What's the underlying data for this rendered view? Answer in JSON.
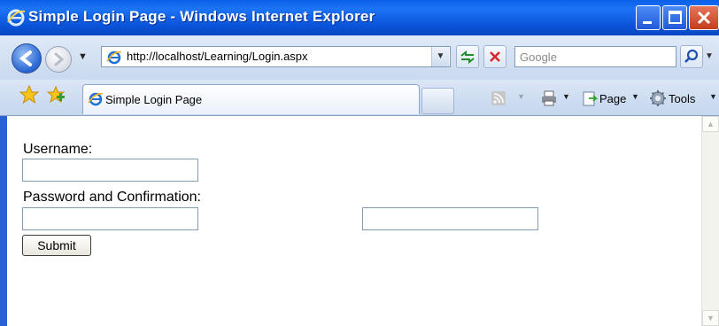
{
  "window": {
    "title": "Simple Login Page - Windows Internet Explorer"
  },
  "address": {
    "url": "http://localhost/Learning/Login.aspx"
  },
  "search": {
    "placeholder": "Google"
  },
  "tab": {
    "label": "Simple Login Page"
  },
  "commands": {
    "page_label": "Page",
    "tools_label": "Tools"
  },
  "form": {
    "username_label": "Username:",
    "password_label": "Password and Confirmation:",
    "submit_label": "Submit",
    "username_value": "",
    "password_value": "",
    "confirmation_value": ""
  },
  "colors": {
    "titlebar": "#0a5fe8",
    "chrome": "#c9d9ef",
    "field_border": "#7f9db9"
  },
  "icons": [
    "ie-logo-icon",
    "minimize-icon",
    "maximize-icon",
    "close-icon",
    "back-icon",
    "forward-icon",
    "refresh-icon",
    "stop-icon",
    "search-icon",
    "favorites-star-icon",
    "add-favorites-icon",
    "rss-feed-icon",
    "print-icon",
    "page-icon",
    "tools-gear-icon"
  ]
}
